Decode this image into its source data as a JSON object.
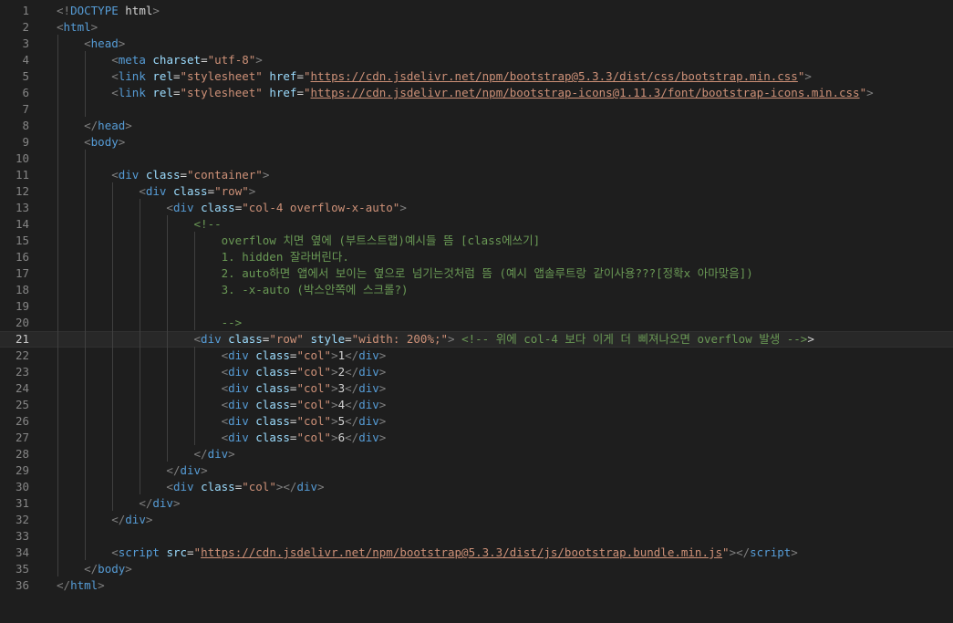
{
  "editor": {
    "active_line": 21,
    "lines": [
      {
        "n": "1",
        "tokens": [
          [
            "punc",
            "<!"
          ],
          [
            "kw",
            "DOCTYPE"
          ],
          [
            "doc",
            " html"
          ],
          [
            "punc",
            ">"
          ]
        ]
      },
      {
        "n": "2",
        "tokens": [
          [
            "punc",
            "<"
          ],
          [
            "tag",
            "html"
          ],
          [
            "punc",
            ">"
          ]
        ]
      },
      {
        "n": "3",
        "tokens": [
          [
            "txt",
            "    "
          ],
          [
            "punc",
            "<"
          ],
          [
            "tag",
            "head"
          ],
          [
            "punc",
            ">"
          ]
        ]
      },
      {
        "n": "4",
        "tokens": [
          [
            "txt",
            "        "
          ],
          [
            "punc",
            "<"
          ],
          [
            "tag",
            "meta"
          ],
          [
            "txt",
            " "
          ],
          [
            "attr",
            "charset"
          ],
          [
            "txt",
            "="
          ],
          [
            "str",
            "\"utf-8\""
          ],
          [
            "punc",
            ">"
          ]
        ]
      },
      {
        "n": "5",
        "tokens": [
          [
            "txt",
            "        "
          ],
          [
            "punc",
            "<"
          ],
          [
            "tag",
            "link"
          ],
          [
            "txt",
            " "
          ],
          [
            "attr",
            "rel"
          ],
          [
            "txt",
            "="
          ],
          [
            "str",
            "\"stylesheet\""
          ],
          [
            "txt",
            " "
          ],
          [
            "attr",
            "href"
          ],
          [
            "txt",
            "="
          ],
          [
            "str",
            "\""
          ],
          [
            "url",
            "https://cdn.jsdelivr.net/npm/bootstrap@5.3.3/dist/css/bootstrap.min.css"
          ],
          [
            "str",
            "\""
          ],
          [
            "punc",
            ">"
          ]
        ]
      },
      {
        "n": "6",
        "tokens": [
          [
            "txt",
            "        "
          ],
          [
            "punc",
            "<"
          ],
          [
            "tag",
            "link"
          ],
          [
            "txt",
            " "
          ],
          [
            "attr",
            "rel"
          ],
          [
            "txt",
            "="
          ],
          [
            "str",
            "\"stylesheet\""
          ],
          [
            "txt",
            " "
          ],
          [
            "attr",
            "href"
          ],
          [
            "txt",
            "="
          ],
          [
            "str",
            "\""
          ],
          [
            "url",
            "https://cdn.jsdelivr.net/npm/bootstrap-icons@1.11.3/font/bootstrap-icons.min.css"
          ],
          [
            "str",
            "\""
          ],
          [
            "punc",
            ">"
          ]
        ]
      },
      {
        "n": "7",
        "tokens": []
      },
      {
        "n": "8",
        "tokens": [
          [
            "txt",
            "    "
          ],
          [
            "punc",
            "</"
          ],
          [
            "tag",
            "head"
          ],
          [
            "punc",
            ">"
          ]
        ]
      },
      {
        "n": "9",
        "tokens": [
          [
            "txt",
            "    "
          ],
          [
            "punc",
            "<"
          ],
          [
            "tag",
            "body"
          ],
          [
            "punc",
            ">"
          ]
        ]
      },
      {
        "n": "10",
        "tokens": []
      },
      {
        "n": "11",
        "tokens": [
          [
            "txt",
            "        "
          ],
          [
            "punc",
            "<"
          ],
          [
            "tag",
            "div"
          ],
          [
            "txt",
            " "
          ],
          [
            "attr",
            "class"
          ],
          [
            "txt",
            "="
          ],
          [
            "str",
            "\"container\""
          ],
          [
            "punc",
            ">"
          ]
        ]
      },
      {
        "n": "12",
        "tokens": [
          [
            "txt",
            "            "
          ],
          [
            "punc",
            "<"
          ],
          [
            "tag",
            "div"
          ],
          [
            "txt",
            " "
          ],
          [
            "attr",
            "class"
          ],
          [
            "txt",
            "="
          ],
          [
            "str",
            "\"row\""
          ],
          [
            "punc",
            ">"
          ]
        ]
      },
      {
        "n": "13",
        "tokens": [
          [
            "txt",
            "                "
          ],
          [
            "punc",
            "<"
          ],
          [
            "tag",
            "div"
          ],
          [
            "txt",
            " "
          ],
          [
            "attr",
            "class"
          ],
          [
            "txt",
            "="
          ],
          [
            "str",
            "\"col-4 overflow-x-auto\""
          ],
          [
            "punc",
            ">"
          ]
        ]
      },
      {
        "n": "14",
        "tokens": [
          [
            "txt",
            "                    "
          ],
          [
            "com",
            "<!--"
          ]
        ]
      },
      {
        "n": "15",
        "tokens": [
          [
            "txt",
            "                        "
          ],
          [
            "com",
            "overflow 치면 옆에 (부트스트랩)예시들 뜸 [class에쓰기]"
          ]
        ]
      },
      {
        "n": "16",
        "tokens": [
          [
            "txt",
            "                        "
          ],
          [
            "com",
            "1. hidden 잘라버린다."
          ]
        ]
      },
      {
        "n": "17",
        "tokens": [
          [
            "txt",
            "                        "
          ],
          [
            "com",
            "2. auto하면 앱에서 보이는 옆으로 넘기는것처럼 뜸 (예시 앱솔루트랑 같이사용???[정확x 아마맞음])"
          ]
        ]
      },
      {
        "n": "18",
        "tokens": [
          [
            "txt",
            "                        "
          ],
          [
            "com",
            "3. -x-auto (박스안쪽에 스크롤?)"
          ]
        ]
      },
      {
        "n": "19",
        "tokens": []
      },
      {
        "n": "20",
        "tokens": [
          [
            "txt",
            "                        "
          ],
          [
            "com",
            "-->"
          ]
        ]
      },
      {
        "n": "21",
        "tokens": [
          [
            "txt",
            "                    "
          ],
          [
            "punc",
            "<"
          ],
          [
            "tag",
            "div"
          ],
          [
            "txt",
            " "
          ],
          [
            "attr",
            "class"
          ],
          [
            "txt",
            "="
          ],
          [
            "str",
            "\"row\""
          ],
          [
            "txt",
            " "
          ],
          [
            "attr",
            "style"
          ],
          [
            "txt",
            "="
          ],
          [
            "str",
            "\"width: 200%;\""
          ],
          [
            "punc",
            ">"
          ],
          [
            "txt",
            " "
          ],
          [
            "com",
            "<!-- 위에 col-4 보다 이게 더 삐져나오면 overflow 발생 -->"
          ],
          [
            "txt",
            ">"
          ]
        ]
      },
      {
        "n": "22",
        "tokens": [
          [
            "txt",
            "                        "
          ],
          [
            "punc",
            "<"
          ],
          [
            "tag",
            "div"
          ],
          [
            "txt",
            " "
          ],
          [
            "attr",
            "class"
          ],
          [
            "txt",
            "="
          ],
          [
            "str",
            "\"col\""
          ],
          [
            "punc",
            ">"
          ],
          [
            "txt",
            "1"
          ],
          [
            "punc",
            "</"
          ],
          [
            "tag",
            "div"
          ],
          [
            "punc",
            ">"
          ]
        ]
      },
      {
        "n": "23",
        "tokens": [
          [
            "txt",
            "                        "
          ],
          [
            "punc",
            "<"
          ],
          [
            "tag",
            "div"
          ],
          [
            "txt",
            " "
          ],
          [
            "attr",
            "class"
          ],
          [
            "txt",
            "="
          ],
          [
            "str",
            "\"col\""
          ],
          [
            "punc",
            ">"
          ],
          [
            "txt",
            "2"
          ],
          [
            "punc",
            "</"
          ],
          [
            "tag",
            "div"
          ],
          [
            "punc",
            ">"
          ]
        ]
      },
      {
        "n": "24",
        "tokens": [
          [
            "txt",
            "                        "
          ],
          [
            "punc",
            "<"
          ],
          [
            "tag",
            "div"
          ],
          [
            "txt",
            " "
          ],
          [
            "attr",
            "class"
          ],
          [
            "txt",
            "="
          ],
          [
            "str",
            "\"col\""
          ],
          [
            "punc",
            ">"
          ],
          [
            "txt",
            "3"
          ],
          [
            "punc",
            "</"
          ],
          [
            "tag",
            "div"
          ],
          [
            "punc",
            ">"
          ]
        ]
      },
      {
        "n": "25",
        "tokens": [
          [
            "txt",
            "                        "
          ],
          [
            "punc",
            "<"
          ],
          [
            "tag",
            "div"
          ],
          [
            "txt",
            " "
          ],
          [
            "attr",
            "class"
          ],
          [
            "txt",
            "="
          ],
          [
            "str",
            "\"col\""
          ],
          [
            "punc",
            ">"
          ],
          [
            "txt",
            "4"
          ],
          [
            "punc",
            "</"
          ],
          [
            "tag",
            "div"
          ],
          [
            "punc",
            ">"
          ]
        ]
      },
      {
        "n": "26",
        "tokens": [
          [
            "txt",
            "                        "
          ],
          [
            "punc",
            "<"
          ],
          [
            "tag",
            "div"
          ],
          [
            "txt",
            " "
          ],
          [
            "attr",
            "class"
          ],
          [
            "txt",
            "="
          ],
          [
            "str",
            "\"col\""
          ],
          [
            "punc",
            ">"
          ],
          [
            "txt",
            "5"
          ],
          [
            "punc",
            "</"
          ],
          [
            "tag",
            "div"
          ],
          [
            "punc",
            ">"
          ]
        ]
      },
      {
        "n": "27",
        "tokens": [
          [
            "txt",
            "                        "
          ],
          [
            "punc",
            "<"
          ],
          [
            "tag",
            "div"
          ],
          [
            "txt",
            " "
          ],
          [
            "attr",
            "class"
          ],
          [
            "txt",
            "="
          ],
          [
            "str",
            "\"col\""
          ],
          [
            "punc",
            ">"
          ],
          [
            "txt",
            "6"
          ],
          [
            "punc",
            "</"
          ],
          [
            "tag",
            "div"
          ],
          [
            "punc",
            ">"
          ]
        ]
      },
      {
        "n": "28",
        "tokens": [
          [
            "txt",
            "                    "
          ],
          [
            "punc",
            "</"
          ],
          [
            "tag",
            "div"
          ],
          [
            "punc",
            ">"
          ]
        ]
      },
      {
        "n": "29",
        "tokens": [
          [
            "txt",
            "                "
          ],
          [
            "punc",
            "</"
          ],
          [
            "tag",
            "div"
          ],
          [
            "punc",
            ">"
          ]
        ]
      },
      {
        "n": "30",
        "tokens": [
          [
            "txt",
            "                "
          ],
          [
            "punc",
            "<"
          ],
          [
            "tag",
            "div"
          ],
          [
            "txt",
            " "
          ],
          [
            "attr",
            "class"
          ],
          [
            "txt",
            "="
          ],
          [
            "str",
            "\"col\""
          ],
          [
            "punc",
            ">"
          ],
          [
            "punc",
            "</"
          ],
          [
            "tag",
            "div"
          ],
          [
            "punc",
            ">"
          ]
        ]
      },
      {
        "n": "31",
        "tokens": [
          [
            "txt",
            "            "
          ],
          [
            "punc",
            "</"
          ],
          [
            "tag",
            "div"
          ],
          [
            "punc",
            ">"
          ]
        ]
      },
      {
        "n": "32",
        "tokens": [
          [
            "txt",
            "        "
          ],
          [
            "punc",
            "</"
          ],
          [
            "tag",
            "div"
          ],
          [
            "punc",
            ">"
          ]
        ]
      },
      {
        "n": "33",
        "tokens": []
      },
      {
        "n": "34",
        "tokens": [
          [
            "txt",
            "        "
          ],
          [
            "punc",
            "<"
          ],
          [
            "tag",
            "script"
          ],
          [
            "txt",
            " "
          ],
          [
            "attr",
            "src"
          ],
          [
            "txt",
            "="
          ],
          [
            "str",
            "\""
          ],
          [
            "url",
            "https://cdn.jsdelivr.net/npm/bootstrap@5.3.3/dist/js/bootstrap.bundle.min.js"
          ],
          [
            "str",
            "\""
          ],
          [
            "punc",
            "></"
          ],
          [
            "tag",
            "script"
          ],
          [
            "punc",
            ">"
          ]
        ]
      },
      {
        "n": "35",
        "tokens": [
          [
            "txt",
            "    "
          ],
          [
            "punc",
            "</"
          ],
          [
            "tag",
            "body"
          ],
          [
            "punc",
            ">"
          ]
        ]
      },
      {
        "n": "36",
        "tokens": [
          [
            "punc",
            "</"
          ],
          [
            "tag",
            "html"
          ],
          [
            "punc",
            ">"
          ]
        ]
      }
    ]
  }
}
